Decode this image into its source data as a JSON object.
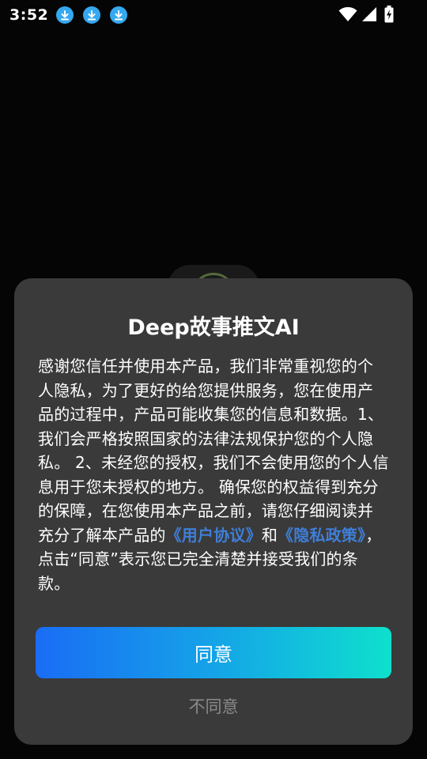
{
  "status_bar": {
    "time": "3:52",
    "notification_icons": [
      "download-icon",
      "download-icon",
      "download-icon"
    ]
  },
  "dialog": {
    "title": "Deep故事推文AI",
    "body_part1": "感谢您信任并使用本产品，我们非常重视您的个人隐私，为了更好的给您提供服务，您在使用产品的过程中，产品可能收集您的信息和数据。1、我们会严格按照国家的法律法规保护您的个人隐私。 2、未经您的授权，我们不会使用您的个人信息用于您未授权的地方。 确保您的权益得到充分的保障，在您使用本产品之前，请您仔细阅读并充分了解本产品的",
    "user_agreement_link": "《用户协议》",
    "body_and": "和",
    "privacy_policy_link": "《隐私政策》",
    "body_part2": "，点击“同意”表示您已完全清楚并接受我们的条款。",
    "agree_label": "同意",
    "disagree_label": "不同意"
  },
  "colors": {
    "link": "#3f7fd8",
    "dialog_bg": "#3a3a3a",
    "button_gradient_start": "#1a6cf5",
    "button_gradient_end": "#0ee0cc",
    "download_icon": "#35a8f0"
  }
}
